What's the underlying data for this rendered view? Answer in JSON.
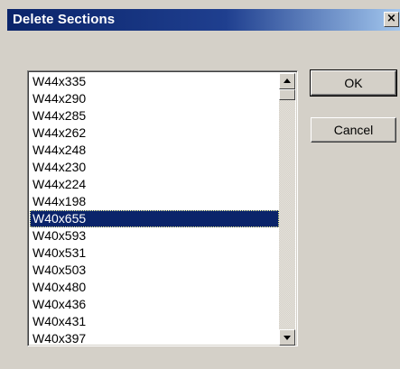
{
  "dialog": {
    "title": "Delete Sections",
    "close_glyph": "×"
  },
  "sections_list": {
    "items": [
      "W44x335",
      "W44x290",
      "W44x285",
      "W44x262",
      "W44x248",
      "W44x230",
      "W44x224",
      "W44x198",
      "W40x655",
      "W40x593",
      "W40x531",
      "W40x503",
      "W40x480",
      "W40x436",
      "W40x431",
      "W40x397"
    ],
    "selected_index": 8
  },
  "buttons": {
    "ok_label": "OK",
    "cancel_label": "Cancel"
  },
  "colors": {
    "dialog_background": "#d4d0c8",
    "titlebar_start": "#0a246a",
    "titlebar_end": "#a6caf0",
    "selection_background": "#0a246a",
    "selection_text": "#ffffff"
  },
  "icons": {
    "close": "close-icon",
    "scroll_up": "arrow-up-icon",
    "scroll_down": "arrow-down-icon"
  }
}
